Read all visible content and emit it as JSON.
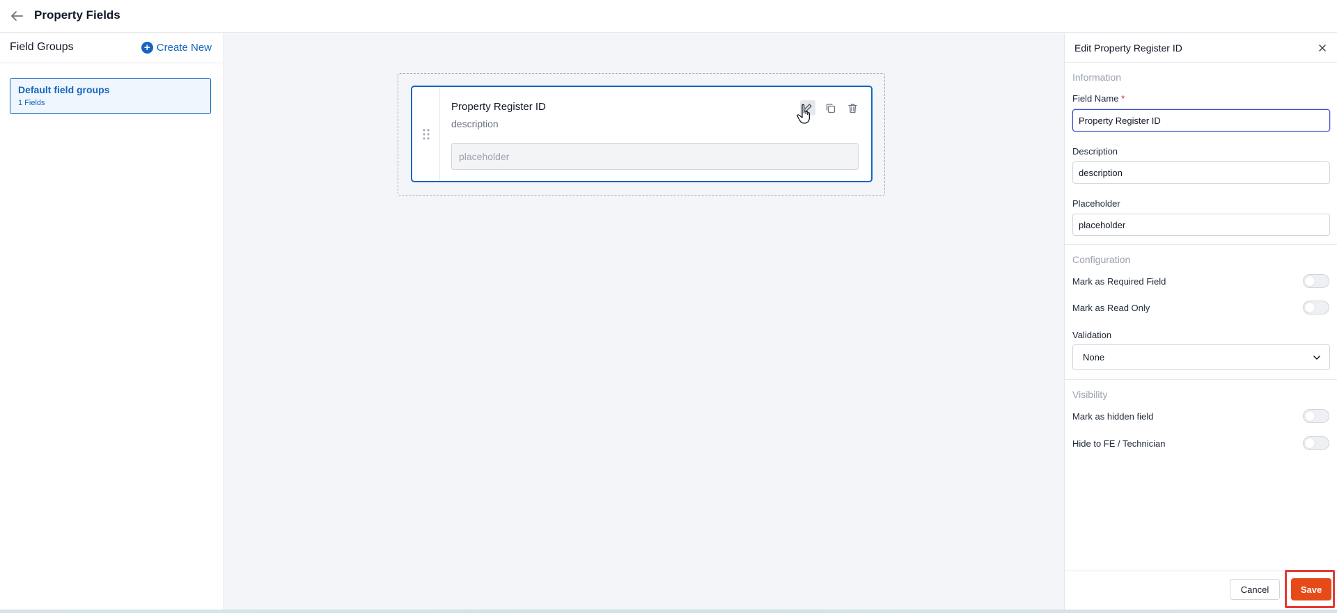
{
  "header": {
    "title": "Property Fields"
  },
  "left_panel": {
    "title": "Field Groups",
    "create_new_label": "Create New",
    "groups": [
      {
        "name": "Default field groups",
        "count": "1 Fields"
      }
    ]
  },
  "canvas": {
    "field": {
      "name": "Property Register ID",
      "description": "description",
      "placeholder": "placeholder"
    }
  },
  "edit_panel": {
    "title": "Edit Property Register ID",
    "information": {
      "section_title": "Information",
      "field_name_label": "Field Name",
      "required_marker": "*",
      "field_name_value": "Property Register ID",
      "description_label": "Description",
      "description_value": "description",
      "placeholder_label": "Placeholder",
      "placeholder_value": "placeholder"
    },
    "configuration": {
      "section_title": "Configuration",
      "required_label": "Mark as Required Field",
      "read_only_label": "Mark as Read Only",
      "validation_label": "Validation",
      "validation_value": "None"
    },
    "visibility": {
      "section_title": "Visibility",
      "hidden_label": "Mark as hidden field",
      "hide_fe_label": "Hide to FE / Technician"
    },
    "footer": {
      "cancel_label": "Cancel",
      "save_label": "Save"
    },
    "toggles": {
      "required": false,
      "read_only": false,
      "hidden": false,
      "hide_fe": false
    }
  },
  "colors": {
    "accent": "#1565c0",
    "save": "#e64a19",
    "highlight": "#e53935"
  }
}
